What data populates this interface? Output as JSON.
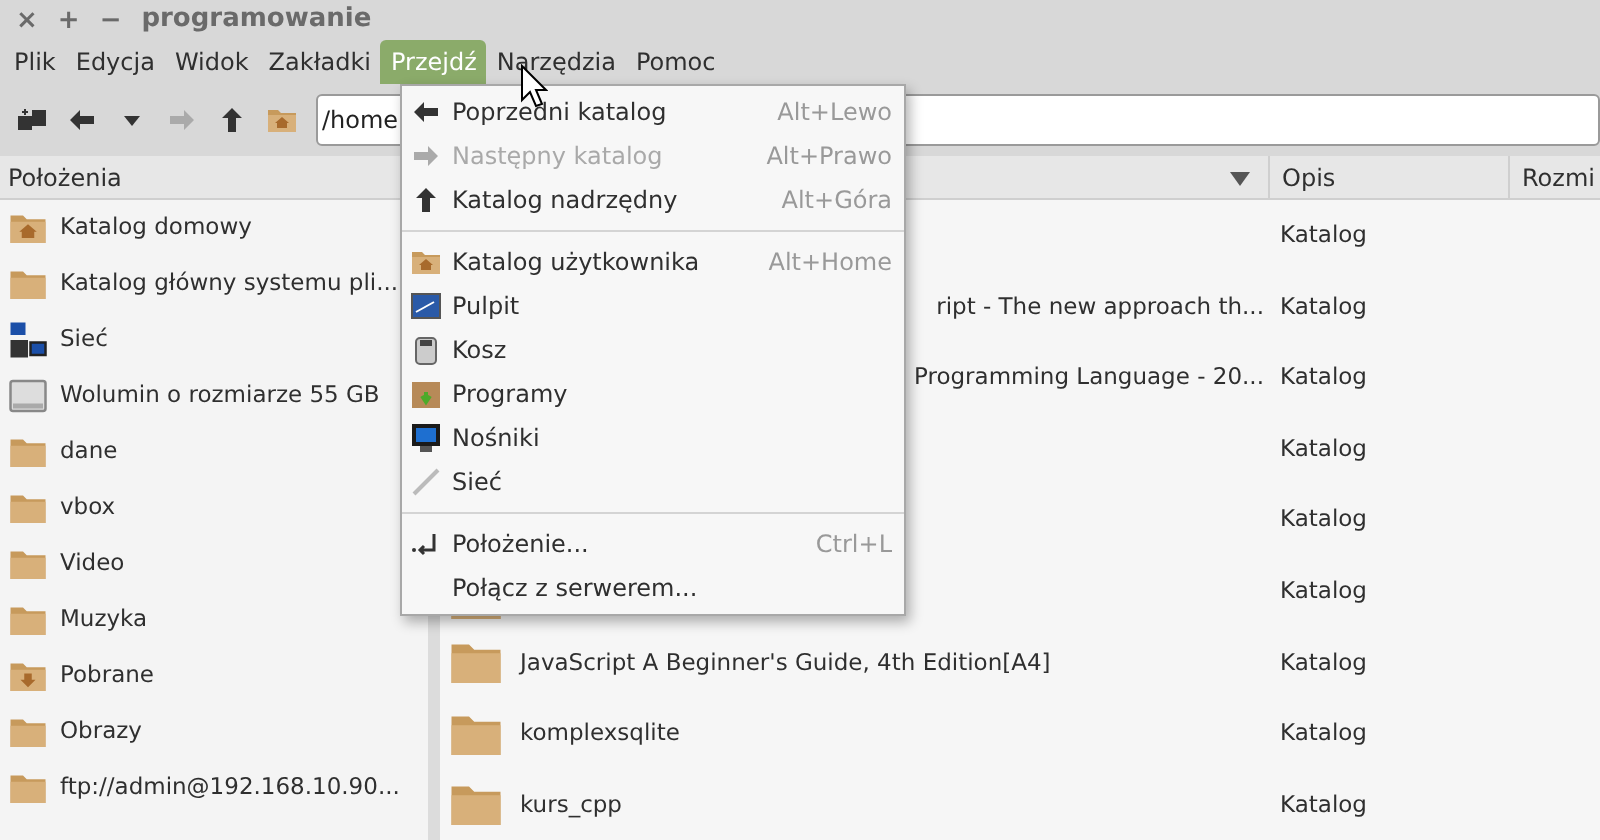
{
  "window": {
    "title": "programowanie",
    "controls": [
      "×",
      "+",
      "−"
    ]
  },
  "menubar": [
    {
      "label": "Plik",
      "selected": false
    },
    {
      "label": "Edycja",
      "selected": false
    },
    {
      "label": "Widok",
      "selected": false
    },
    {
      "label": "Zakładki",
      "selected": false
    },
    {
      "label": "Przejdź",
      "selected": true
    },
    {
      "label": "Narzędzia",
      "selected": false
    },
    {
      "label": "Pomoc",
      "selected": false
    }
  ],
  "toolbar": {
    "path": "/home"
  },
  "sidebar": {
    "title": "Położenia",
    "items": [
      {
        "kind": "home",
        "label": "Katalog domowy"
      },
      {
        "kind": "folder",
        "label": "Katalog główny systemu pli..."
      },
      {
        "kind": "network",
        "label": "Sieć"
      },
      {
        "kind": "drive",
        "label": "Wolumin o rozmiarze 55 GB"
      },
      {
        "kind": "folder",
        "label": "dane"
      },
      {
        "kind": "folder",
        "label": "vbox"
      },
      {
        "kind": "folder",
        "label": "Video"
      },
      {
        "kind": "folder",
        "label": "Muzyka"
      },
      {
        "kind": "download",
        "label": "Pobrane"
      },
      {
        "kind": "folder",
        "label": "Obrazy"
      },
      {
        "kind": "folder",
        "label": "ftp://admin@192.168.10.90..."
      }
    ]
  },
  "file_list": {
    "columns": [
      "Opis",
      "Rozmi"
    ],
    "rows": [
      {
        "kind": "covered",
        "description": "Katalog"
      },
      {
        "kind": "covered",
        "name": "ript - The new approach th...",
        "description": "Katalog"
      },
      {
        "kind": "covered",
        "name": "Programming Language - 20...",
        "description": "Katalog"
      },
      {
        "kind": "covered",
        "description": "Katalog"
      },
      {
        "kind": "covered",
        "description": "Katalog"
      },
      {
        "kind": "partly_covered",
        "description": "Katalog"
      },
      {
        "kind": "folder",
        "name": "JavaScript A Beginner's Guide, 4th Edition[A4]",
        "description": "Katalog"
      },
      {
        "kind": "folder",
        "name": "komplexsqlite",
        "description": "Katalog"
      },
      {
        "kind": "folder",
        "name": "kurs_cpp",
        "description": "Katalog"
      }
    ]
  },
  "go_menu": {
    "items": [
      {
        "kind": "item",
        "label": "Poprzedni katalog",
        "shortcut": "Alt+Lewo",
        "disabled": false
      },
      {
        "kind": "item",
        "label": "Następny katalog",
        "shortcut": "Alt+Prawo",
        "disabled": true
      },
      {
        "kind": "item",
        "label": "Katalog nadrzędny",
        "shortcut": "Alt+Góra",
        "disabled": false
      },
      {
        "kind": "separator"
      },
      {
        "kind": "item",
        "label": "Katalog użytkownika",
        "shortcut": "Alt+Home",
        "disabled": false
      },
      {
        "kind": "item",
        "label": "Pulpit",
        "disabled": false
      },
      {
        "kind": "item",
        "label": "Kosz",
        "disabled": false
      },
      {
        "kind": "item",
        "label": "Programy",
        "disabled": false
      },
      {
        "kind": "item",
        "label": "Nośniki",
        "disabled": false
      },
      {
        "kind": "item",
        "label": "Sieć",
        "disabled": false
      },
      {
        "kind": "separator"
      },
      {
        "kind": "item",
        "label": "Położenie...",
        "shortcut": "Ctrl+L",
        "disabled": false
      },
      {
        "kind": "item",
        "label": "Połącz z serwerem...",
        "disabled": false
      }
    ]
  }
}
